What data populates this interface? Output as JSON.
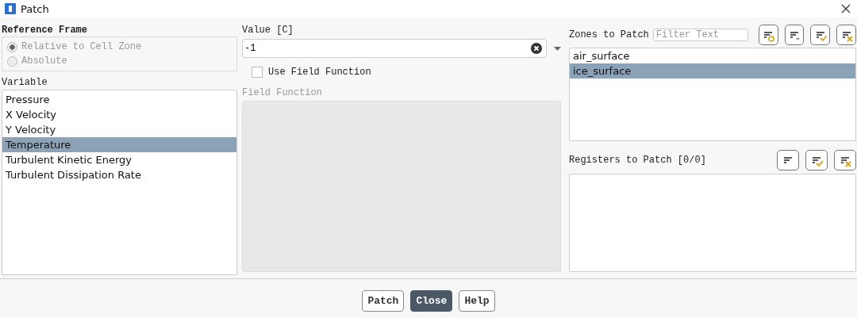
{
  "window": {
    "title": "Patch"
  },
  "reference_frame": {
    "label": "Reference Frame",
    "options": [
      {
        "label": "Relative to Cell Zone",
        "selected": true,
        "disabled": true
      },
      {
        "label": "Absolute",
        "selected": false,
        "disabled": true
      }
    ]
  },
  "variable": {
    "label": "Variable",
    "items": [
      {
        "label": "Pressure",
        "selected": false
      },
      {
        "label": "X Velocity",
        "selected": false
      },
      {
        "label": "Y Velocity",
        "selected": false
      },
      {
        "label": "Temperature",
        "selected": true
      },
      {
        "label": "Turbulent Kinetic Energy",
        "selected": false
      },
      {
        "label": "Turbulent Dissipation Rate",
        "selected": false
      }
    ]
  },
  "value": {
    "label": "Value [C]",
    "value": "-1"
  },
  "use_field_function": {
    "label": "Use Field Function",
    "checked": false
  },
  "field_function": {
    "label": "Field Function",
    "disabled": true
  },
  "zones": {
    "label": "Zones to Patch",
    "filter_placeholder": "Filter Text",
    "tools": [
      {
        "kind": "ring"
      },
      {
        "kind": "dropdown"
      },
      {
        "kind": "check"
      },
      {
        "kind": "cross"
      }
    ],
    "items": [
      {
        "label": "air_surface",
        "selected": false
      },
      {
        "label": "ice_surface",
        "selected": true
      }
    ]
  },
  "registers": {
    "label": "Registers to Patch [0/0]",
    "tools": [
      {
        "kind": "plain"
      },
      {
        "kind": "check"
      },
      {
        "kind": "cross"
      }
    ]
  },
  "buttons": [
    {
      "label": "Patch",
      "primary": false
    },
    {
      "label": "Close",
      "primary": true
    },
    {
      "label": "Help",
      "primary": false
    }
  ]
}
